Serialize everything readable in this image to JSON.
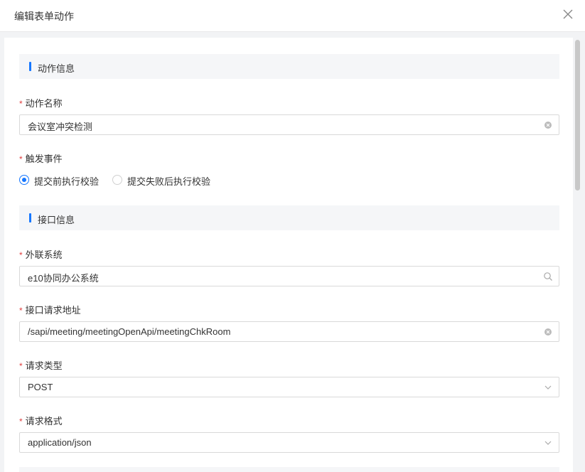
{
  "modal": {
    "title": "编辑表单动作",
    "close_icon": "close-icon"
  },
  "sections": {
    "action_info": {
      "title": "动作信息"
    },
    "api_info": {
      "title": "接口信息"
    }
  },
  "fields": {
    "action_name": {
      "label": "动作名称",
      "required_mark": "*",
      "value": "会议室冲突检测",
      "icon": "clear-icon"
    },
    "trigger_event": {
      "label": "触发事件",
      "required_mark": "*",
      "options": [
        {
          "label": "提交前执行校验",
          "checked": true
        },
        {
          "label": "提交失败后执行校验",
          "checked": false
        }
      ]
    },
    "external_system": {
      "label": "外联系统",
      "required_mark": "*",
      "value": "e10协同办公系统",
      "icon": "search-icon"
    },
    "request_url": {
      "label": "接口请求地址",
      "required_mark": "*",
      "value": "/sapi/meeting/meetingOpenApi/meetingChkRoom",
      "icon": "clear-icon"
    },
    "request_type": {
      "label": "请求类型",
      "required_mark": "*",
      "value": "POST",
      "icon": "chevron-down-icon"
    },
    "request_format": {
      "label": "请求格式",
      "required_mark": "*",
      "value": "application/json",
      "icon": "chevron-down-icon"
    }
  },
  "colors": {
    "accent": "#1677ff",
    "required": "#e03e3e",
    "section_bg": "#f5f6f8"
  }
}
